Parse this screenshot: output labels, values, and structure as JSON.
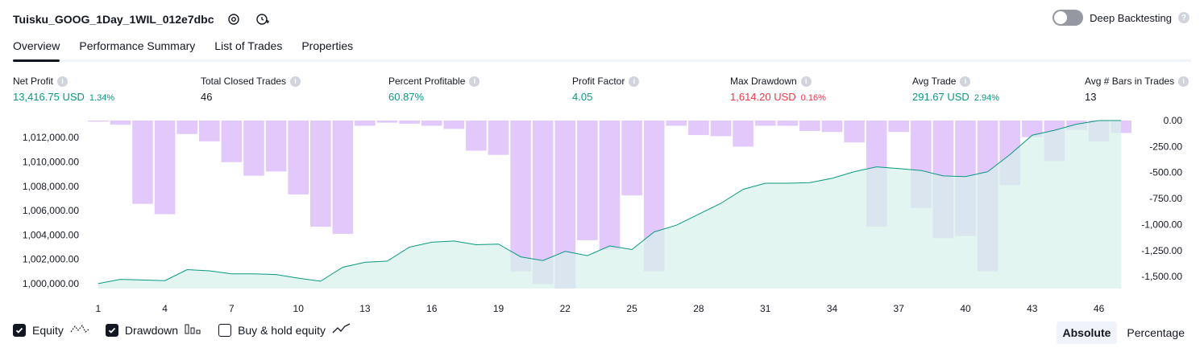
{
  "header": {
    "title": "Tuisku_GOOG_1Day_1WIL_012e7dbc",
    "deep_backtesting_label": "Deep Backtesting",
    "deep_backtesting_on": false
  },
  "tabs": [
    {
      "label": "Overview",
      "active": true
    },
    {
      "label": "Performance Summary",
      "active": false
    },
    {
      "label": "List of Trades",
      "active": false
    },
    {
      "label": "Properties",
      "active": false
    }
  ],
  "metrics": {
    "net_profit": {
      "label": "Net Profit",
      "value": "13,416.75 USD",
      "pct": "1.34%"
    },
    "total_closed_trades": {
      "label": "Total Closed Trades",
      "value": "46"
    },
    "percent_profitable": {
      "label": "Percent Profitable",
      "value": "60.87%"
    },
    "profit_factor": {
      "label": "Profit Factor",
      "value": "4.05"
    },
    "max_drawdown": {
      "label": "Max Drawdown",
      "value": "1,614.20 USD",
      "pct": "0.16%"
    },
    "avg_trade": {
      "label": "Avg Trade",
      "value": "291.67 USD",
      "pct": "2.94%"
    },
    "avg_bars": {
      "label": "Avg # Bars in Trades",
      "value": "13"
    }
  },
  "chart_data": {
    "type": "area",
    "x_ticks": [
      "1",
      "4",
      "7",
      "10",
      "13",
      "16",
      "19",
      "22",
      "25",
      "28",
      "31",
      "34",
      "37",
      "40",
      "43",
      "46"
    ],
    "left_axis": {
      "ticks": [
        "1,012,000.00",
        "1,010,000.00",
        "1,008,000.00",
        "1,006,000.00",
        "1,004,000.00",
        "1,002,000.00",
        "1,000,000.00"
      ],
      "tick_values": [
        1012000,
        1010000,
        1008000,
        1006000,
        1004000,
        1002000,
        1000000
      ],
      "ylim": [
        999600,
        1013400
      ]
    },
    "right_axis": {
      "ticks": [
        "0.00",
        "-250.00",
        "-500.00",
        "-750.00",
        "-1,000.00",
        "-1,250.00",
        "-1,500.00"
      ],
      "tick_values": [
        0,
        -250,
        -500,
        -750,
        -1000,
        -1250,
        -1500
      ],
      "ylim": [
        -1614.2,
        0
      ]
    },
    "series": [
      {
        "name": "Equity",
        "color": "#089981",
        "fill": "#d7f1ea",
        "values": [
          1000000,
          1000350,
          1000300,
          1000250,
          1001150,
          1001050,
          1000800,
          1000800,
          1000750,
          1000450,
          1000200,
          1001350,
          1001750,
          1001850,
          1003000,
          1003400,
          1003500,
          1003200,
          1003250,
          1002200,
          1001900,
          1002650,
          1002300,
          1003100,
          1002800,
          1004250,
          1004800,
          1005700,
          1006600,
          1007750,
          1008250,
          1008250,
          1008300,
          1008650,
          1009200,
          1009600,
          1009450,
          1009300,
          1008850,
          1008800,
          1009200,
          1010600,
          1012200,
          1012600,
          1013100,
          1013400,
          1013400
        ]
      },
      {
        "name": "Drawdown",
        "color": "#e1c6fb",
        "values": [
          -10,
          -40,
          -800,
          -900,
          -130,
          -200,
          -400,
          -530,
          -490,
          -710,
          -1020,
          -1090,
          -50,
          -20,
          -30,
          -50,
          -80,
          -290,
          -330,
          -1450,
          -1570,
          -1614,
          -1150,
          -1240,
          -720,
          -1450,
          -50,
          -140,
          -150,
          -250,
          -50,
          -50,
          -100,
          -110,
          -210,
          -1020,
          -110,
          -840,
          -1130,
          -1110,
          -1450,
          -620,
          -160,
          -390,
          -90,
          -200,
          -120
        ]
      }
    ]
  },
  "legend": [
    {
      "label": "Equity",
      "checked": true,
      "icon": "equity-line-icon"
    },
    {
      "label": "Drawdown",
      "checked": true,
      "icon": "drawdown-bars-icon"
    },
    {
      "label": "Buy & hold equity",
      "checked": false,
      "icon": "buy-hold-line-icon"
    }
  ],
  "modes": [
    {
      "label": "Absolute",
      "active": true
    },
    {
      "label": "Percentage",
      "active": false
    }
  ]
}
